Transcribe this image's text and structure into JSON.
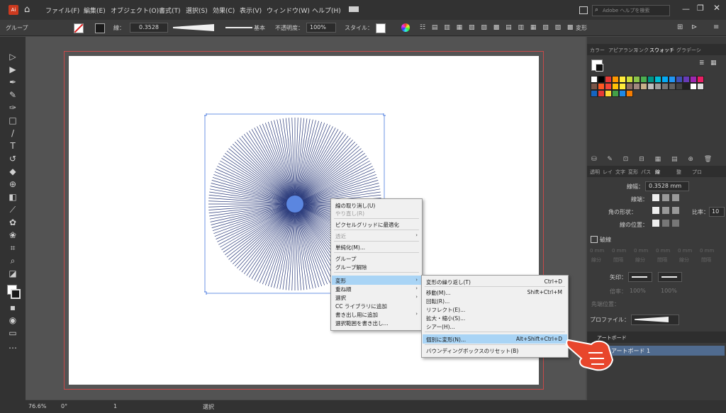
{
  "menubar": {
    "items": [
      "ファイル(F)",
      "編集(E)",
      "オブジェクト(O)",
      "書式(T)",
      "選択(S)",
      "効果(C)",
      "表示(V)",
      "ウィンドウ(W)",
      "ヘルプ(H)"
    ],
    "search_placeholder": "Adobe ヘルプを検索"
  },
  "control": {
    "mode": "グループ",
    "stroke_label": "線：",
    "stroke_value": "0.3528",
    "style_label": "基本",
    "opacity_label": "不透明度：",
    "opacity_value": "100%",
    "style2_label": "スタイル：",
    "transform_label": "変形"
  },
  "panel": {
    "top_tabs": [
      "カラー",
      "アピアランス",
      "リンク",
      "スウォッチ",
      "グラデーシ"
    ],
    "second_tabs": [
      "透明",
      "レイ",
      "文字",
      "変形",
      "パス",
      "線",
      "整",
      "プロ"
    ],
    "stroke": {
      "weight_label": "線幅：",
      "weight_value": "0.3528 mm",
      "cap_label": "線端：",
      "corner_label": "角の形状：",
      "limit_label": "比率：",
      "limit_value": "10",
      "align_label": "線の位置："
    },
    "dash_label": "破線",
    "dash_cells": [
      "0 mm",
      "0 mm",
      "0 mm",
      "0 mm",
      "0 mm",
      "0 mm"
    ],
    "dash_sub": [
      "線分",
      "間隔",
      "線分",
      "間隔",
      "線分",
      "間隔"
    ],
    "arrow_label": "矢印：",
    "scale_label": "倍率：",
    "scale_values": [
      "100%",
      "100%"
    ],
    "align_arrow_label": "先端位置：",
    "profile_label": "プロファイル：",
    "artboard_tab": "アートボード",
    "artboard_item": "アートボード 1"
  },
  "status": {
    "zoom": "76.6%",
    "rotate": "0°",
    "page": "1",
    "tool": "選択"
  },
  "context_menu": {
    "items": [
      "線の取り消し(U)",
      "やり直し(R)",
      "ピクセルグリッドに最適化",
      "透近",
      "単純化(M)...",
      "グループ",
      "グループ解除",
      "変形",
      "重ね順",
      "選択",
      "CC ライブラリに追加",
      "書き出し用に追加",
      "選択範囲を書き出し..."
    ]
  },
  "submenu": {
    "items": [
      {
        "label": "変形の繰り返し(T)",
        "shortcut": "Ctrl+D"
      },
      {
        "label": "移動(M)...",
        "shortcut": "Shift+Ctrl+M"
      },
      {
        "label": "回転(R)...",
        "shortcut": ""
      },
      {
        "label": "リフレクト(E)...",
        "shortcut": ""
      },
      {
        "label": "拡大・縮小(S)...",
        "shortcut": ""
      },
      {
        "label": "シアー(H)...",
        "shortcut": ""
      },
      {
        "label": "個別に変形(N)...",
        "shortcut": "Alt+Shift+Ctrl+D"
      },
      {
        "label": "バウンディングボックスのリセット(B)",
        "shortcut": ""
      }
    ]
  },
  "colors": {
    "accent_highlight": "#a9d4f5",
    "starburst_line": "#2a3a7a",
    "starburst_center": "#5b86e0",
    "pointer_hand": "#e8462c"
  },
  "swatch_colors": [
    "#ffffff",
    "#000000",
    "#e53935",
    "#ff9800",
    "#ffeb3b",
    "#cddc39",
    "#8bc34a",
    "#4caf50",
    "#009688",
    "#00bcd4",
    "#03a9f4",
    "#2196f3",
    "#3f51b5",
    "#673ab7",
    "#9c27b0",
    "#e91e63",
    "#795548",
    "#ff5722",
    "#f44336",
    "#ffc107",
    "#ffeb3b",
    "#8d6e63",
    "#a1887f",
    "#c8b08a",
    "#bdbdbd",
    "#9e9e9e",
    "#757575",
    "#616161",
    "#424242",
    "#212121",
    "#ffffff",
    "#e0e0e0",
    "#1565c0",
    "#e53935",
    "#fdd835",
    "#43a047",
    "#1e88e5",
    "#f57c00"
  ]
}
